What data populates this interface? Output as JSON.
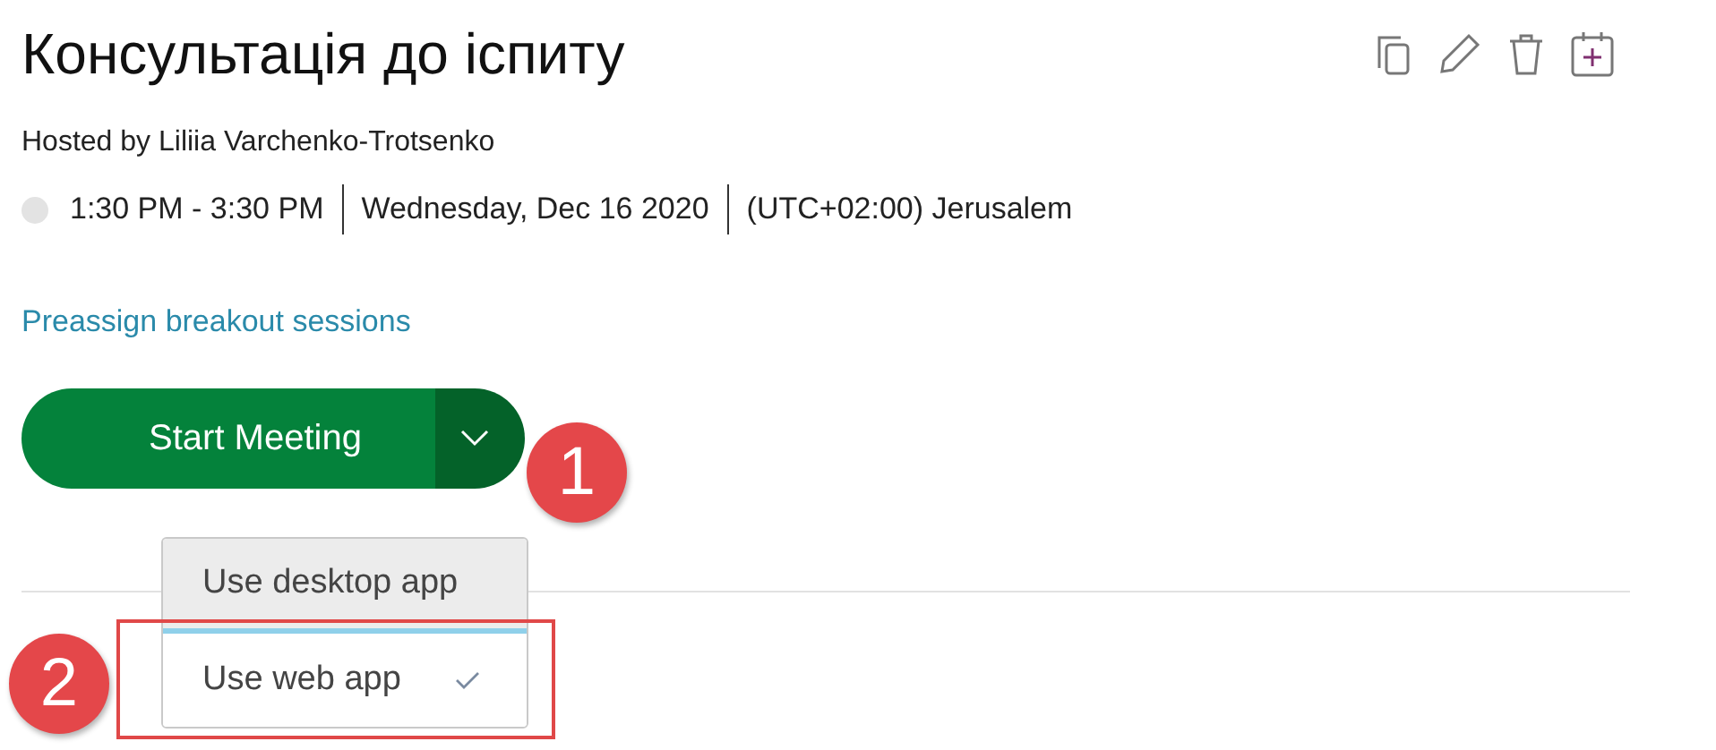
{
  "title": "Консультація до іспиту",
  "host": "Hosted by Liliia Varchenko-Trotsenko",
  "time": "1:30 PM - 3:30 PM",
  "date": "Wednesday, Dec 16 2020",
  "timezone": "(UTC+02:00) Jerusalem",
  "link": "Preassign breakout sessions",
  "start_button": "Start Meeting",
  "menu": [
    {
      "label": "Use desktop app",
      "selected": false
    },
    {
      "label": "Use web app",
      "selected": true
    }
  ],
  "callouts": [
    "1",
    "2"
  ]
}
